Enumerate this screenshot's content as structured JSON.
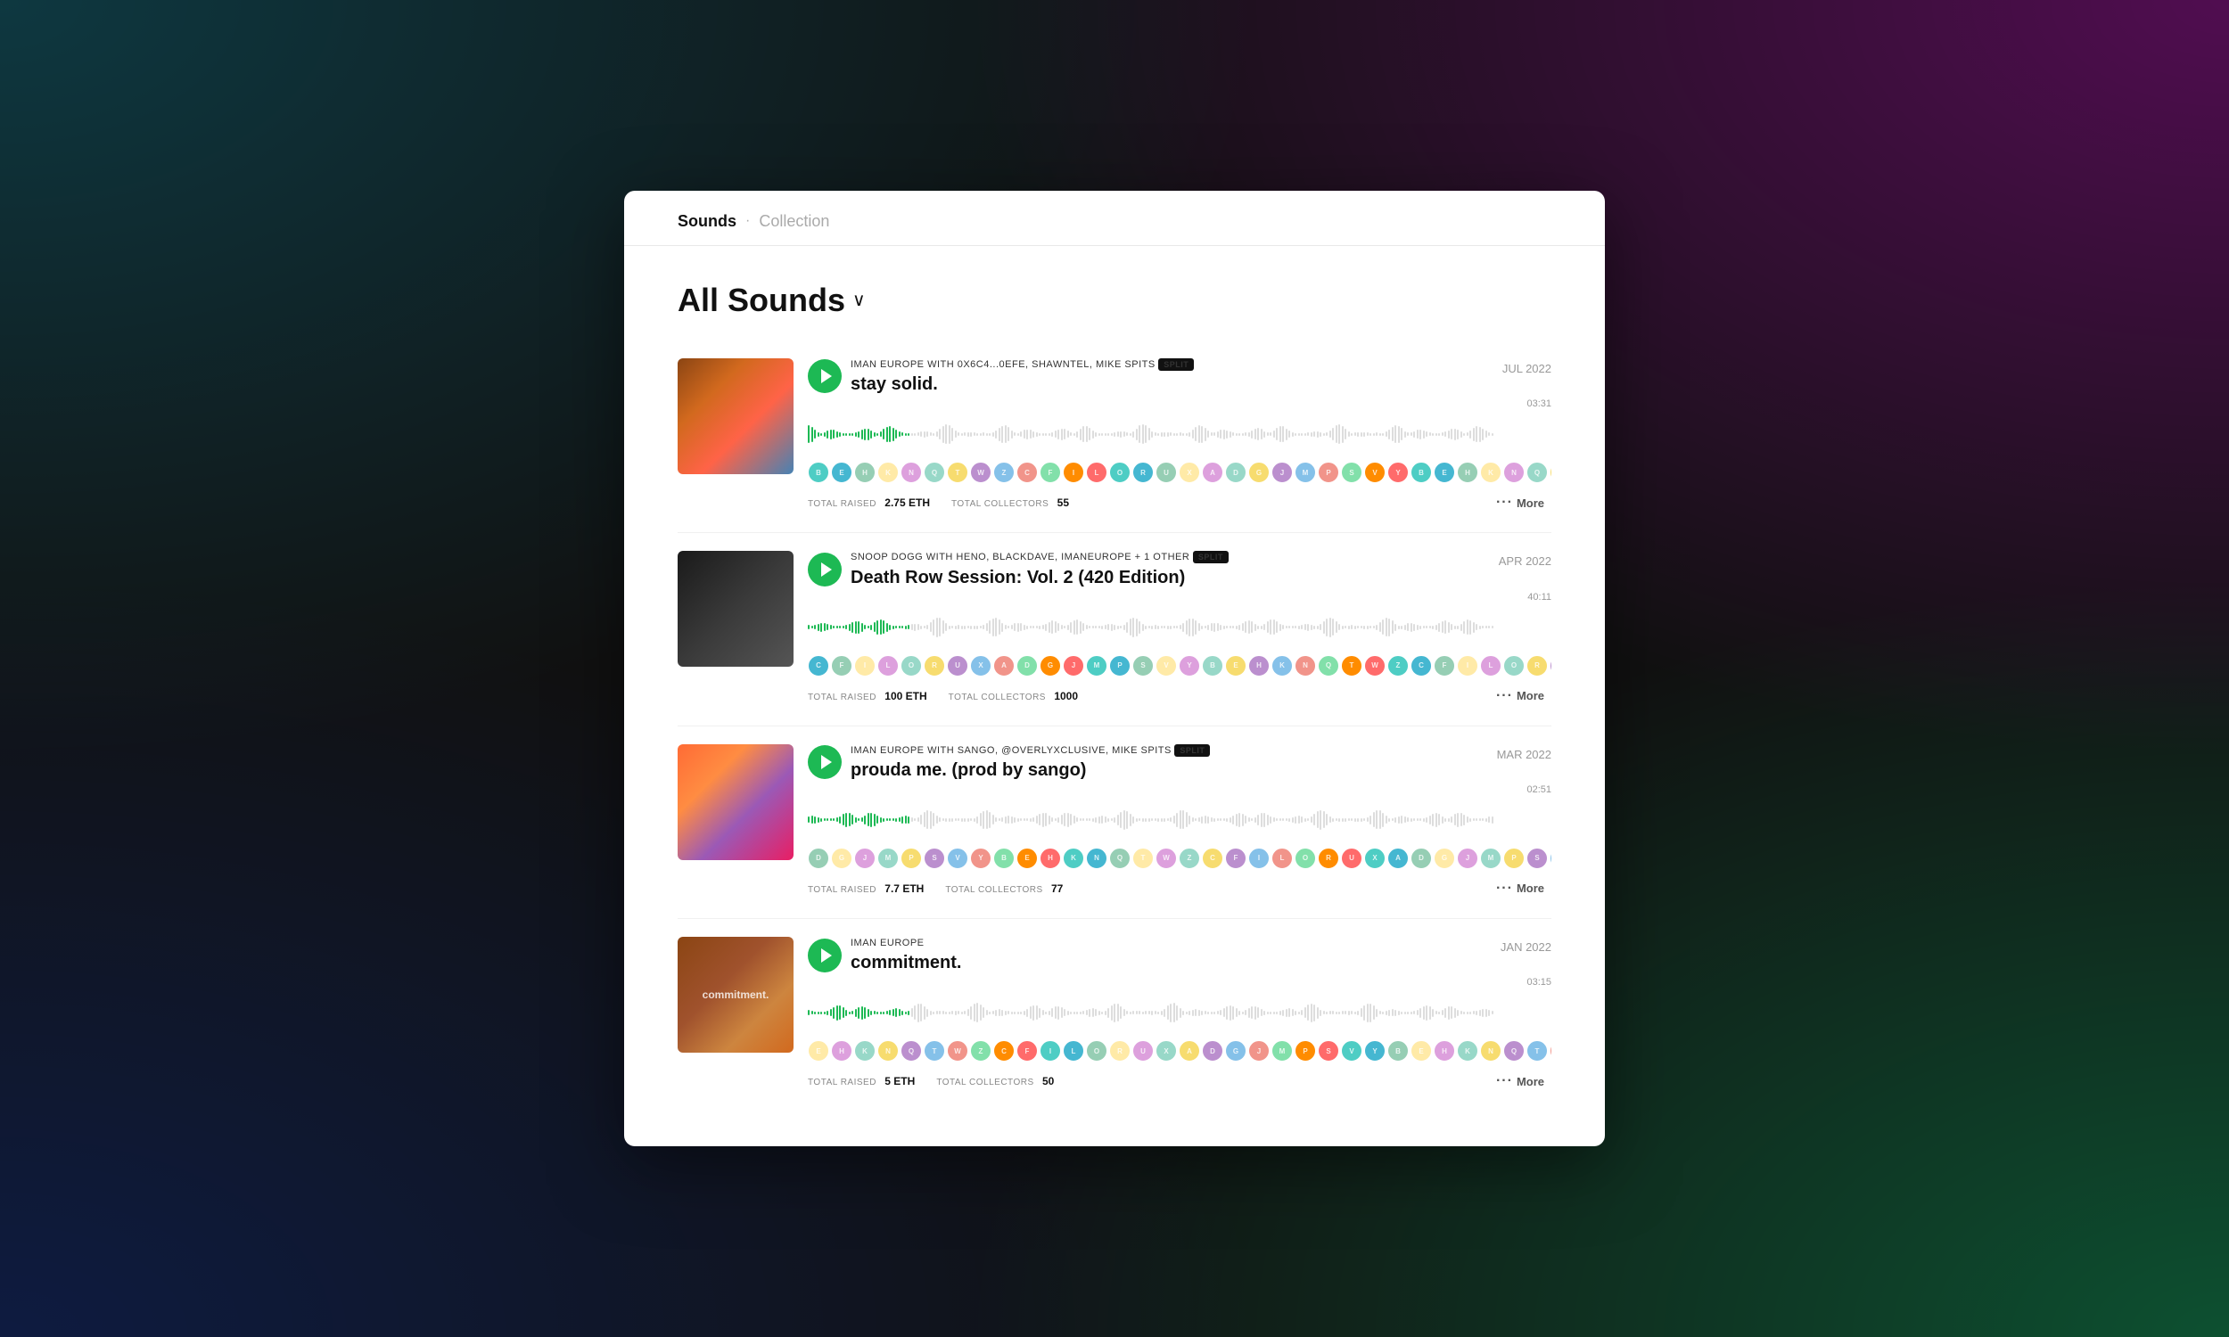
{
  "breadcrumb": {
    "sounds": "Sounds",
    "dot": "·",
    "collection": "Collection"
  },
  "section": {
    "title": "All Sounds",
    "dropdown_arrow": "∨"
  },
  "tracks": [
    {
      "id": 1,
      "artists": "IMAN EUROPE WITH 0X6C4...0EFE, SHAWNTEL, MIKE SPITS",
      "split": "SPLIT",
      "title": "stay solid.",
      "date": "JUL 2022",
      "duration": "03:31",
      "total_raised_label": "TOTAL RAISED",
      "total_raised_value": "2.75 ETH",
      "total_collectors_label": "TOTAL COLLECTORS",
      "total_collectors_value": "55",
      "more_label": "More"
    },
    {
      "id": 2,
      "artists": "SNOOP DOGG WITH HENO, BLACKDAVE, IMANEUROPE + 1 OTHER",
      "split": "SPLIT",
      "title": "Death Row Session: Vol. 2 (420 Edition)",
      "date": "APR 2022",
      "duration": "40:11",
      "total_raised_label": "TOTAL RAISED",
      "total_raised_value": "100 ETH",
      "total_collectors_label": "TOTAL COLLECTORS",
      "total_collectors_value": "1000",
      "more_label": "More"
    },
    {
      "id": 3,
      "artists": "IMAN EUROPE WITH SANGO, @OVERLYXCLUSIVE, MIKE SPITS",
      "split": "SPLIT",
      "title": "prouda me. (prod by sango)",
      "date": "MAR 2022",
      "duration": "02:51",
      "total_raised_label": "TOTAL RAISED",
      "total_raised_value": "7.7 ETH",
      "total_collectors_label": "TOTAL COLLECTORS",
      "total_collectors_value": "77",
      "more_label": "More"
    },
    {
      "id": 4,
      "artists": "IMAN EUROPE",
      "split": null,
      "title": "commitment.",
      "date": "JAN 2022",
      "duration": "03:15",
      "total_raised_label": "TOTAL RAISED",
      "total_raised_value": "5 ETH",
      "total_collectors_label": "TOTAL COLLECTORS",
      "total_collectors_value": "50",
      "more_label": "More"
    }
  ]
}
